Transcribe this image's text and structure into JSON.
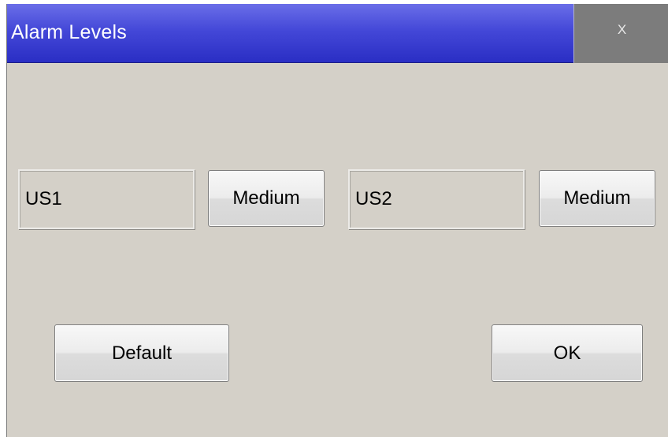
{
  "window": {
    "title": "Alarm Levels",
    "close_label": "X"
  },
  "channels": [
    {
      "label": "US1",
      "level": "Medium"
    },
    {
      "label": "US2",
      "level": "Medium"
    }
  ],
  "buttons": {
    "default_label": "Default",
    "ok_label": "OK"
  },
  "colors": {
    "titlebar": "#4448d8",
    "background": "#d4d0c8",
    "close_button": "#7c7c7c"
  }
}
